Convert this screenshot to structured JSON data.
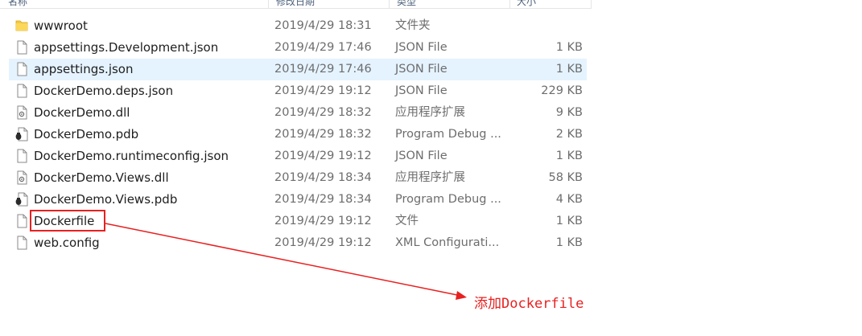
{
  "header": {
    "col_name": "名称",
    "col_date": "修改日期",
    "col_type": "类型",
    "col_size": "大小"
  },
  "files": [
    {
      "name": "wwwroot",
      "date": "2019/4/29 18:31",
      "type": "文件夹",
      "size": "",
      "icon": "folder-icon",
      "selected": false
    },
    {
      "name": "appsettings.Development.json",
      "date": "2019/4/29 17:46",
      "type": "JSON File",
      "size": "1 KB",
      "icon": "file-icon",
      "selected": false
    },
    {
      "name": "appsettings.json",
      "date": "2019/4/29 17:46",
      "type": "JSON File",
      "size": "1 KB",
      "icon": "file-icon",
      "selected": true
    },
    {
      "name": "DockerDemo.deps.json",
      "date": "2019/4/29 19:12",
      "type": "JSON File",
      "size": "229 KB",
      "icon": "file-icon",
      "selected": false
    },
    {
      "name": "DockerDemo.dll",
      "date": "2019/4/29 18:32",
      "type": "应用程序扩展",
      "size": "9 KB",
      "icon": "dll-icon",
      "selected": false
    },
    {
      "name": "DockerDemo.pdb",
      "date": "2019/4/29 18:32",
      "type": "Program Debug ...",
      "size": "2 KB",
      "icon": "pdb-icon",
      "selected": false
    },
    {
      "name": "DockerDemo.runtimeconfig.json",
      "date": "2019/4/29 19:12",
      "type": "JSON File",
      "size": "1 KB",
      "icon": "file-icon",
      "selected": false
    },
    {
      "name": "DockerDemo.Views.dll",
      "date": "2019/4/29 18:34",
      "type": "应用程序扩展",
      "size": "58 KB",
      "icon": "dll-icon",
      "selected": false
    },
    {
      "name": "DockerDemo.Views.pdb",
      "date": "2019/4/29 18:34",
      "type": "Program Debug ...",
      "size": "4 KB",
      "icon": "pdb-icon",
      "selected": false
    },
    {
      "name": "Dockerfile",
      "date": "2019/4/29 19:12",
      "type": "文件",
      "size": "1 KB",
      "icon": "file-icon",
      "selected": false
    },
    {
      "name": "web.config",
      "date": "2019/4/29 19:12",
      "type": "XML Configurati...",
      "size": "1 KB",
      "icon": "file-icon",
      "selected": false
    }
  ],
  "annotation": {
    "label": "添加Dockerfile",
    "color": "#e82020"
  },
  "colors": {
    "selection": "#e5f3ff",
    "folder": "#f6c93d"
  }
}
